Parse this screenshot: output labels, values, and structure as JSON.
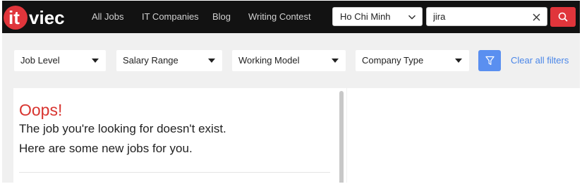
{
  "brand": {
    "logo_text_it": "it",
    "logo_text_viec": "viec",
    "logo_color": "#e0353b"
  },
  "nav": {
    "links": [
      "All Jobs",
      "IT Companies",
      "Blog",
      "Writing Contest"
    ]
  },
  "search": {
    "city": "Ho Chi Minh",
    "query": "jira",
    "button_icon": "search-icon"
  },
  "filters": {
    "items": [
      "Job Level",
      "Salary Range",
      "Working Model",
      "Company Type"
    ],
    "filter_icon": "funnel-icon",
    "clear_all": "Clear all filters"
  },
  "empty_state": {
    "title": "Oops!",
    "line1": "The job you're looking for doesn't exist.",
    "line2": "Here are some new jobs for you."
  },
  "colors": {
    "accent_red": "#e0353b",
    "filter_blue": "#5a8ff0",
    "link_blue": "#4a86e8"
  }
}
